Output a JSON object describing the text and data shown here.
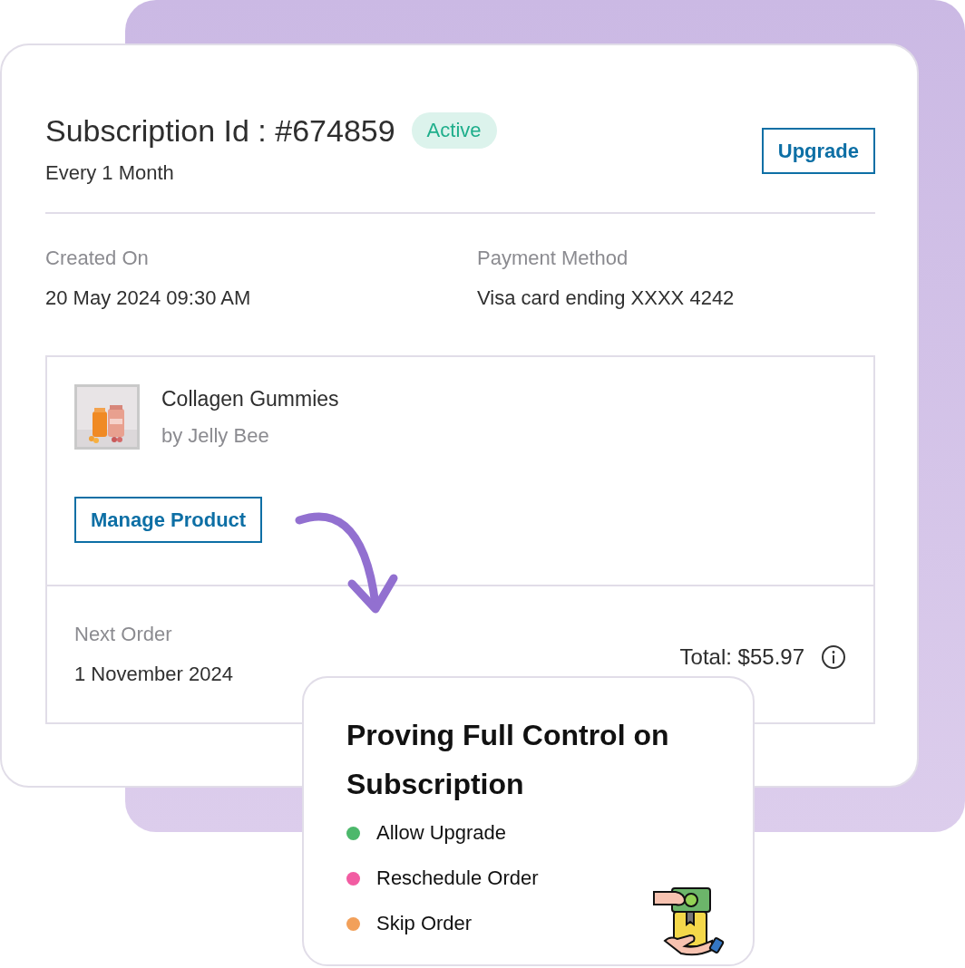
{
  "subscription": {
    "title": "Subscription Id : #674859",
    "status": "Active",
    "frequency": "Every 1 Month",
    "upgrade_button": "Upgrade"
  },
  "details": [
    {
      "label": "Created On",
      "value": "20 May 2024 09:30 AM"
    },
    {
      "label": "Payment Method",
      "value": "Visa card ending XXXX 4242"
    }
  ],
  "product": {
    "name": "Collagen Gummies",
    "vendor": "by Jelly Bee",
    "manage_button": "Manage Product"
  },
  "next_order": {
    "label": "Next Order",
    "date": "1 November 2024",
    "total": "Total: $55.97"
  },
  "feature_card": {
    "title": "Proving Full Control on Subscription",
    "items": [
      {
        "label": "Allow Upgrade",
        "color": "#4cb86b"
      },
      {
        "label": "Reschedule Order",
        "color": "#f25ca2"
      },
      {
        "label": "Skip Order",
        "color": "#f2a05a"
      }
    ]
  }
}
